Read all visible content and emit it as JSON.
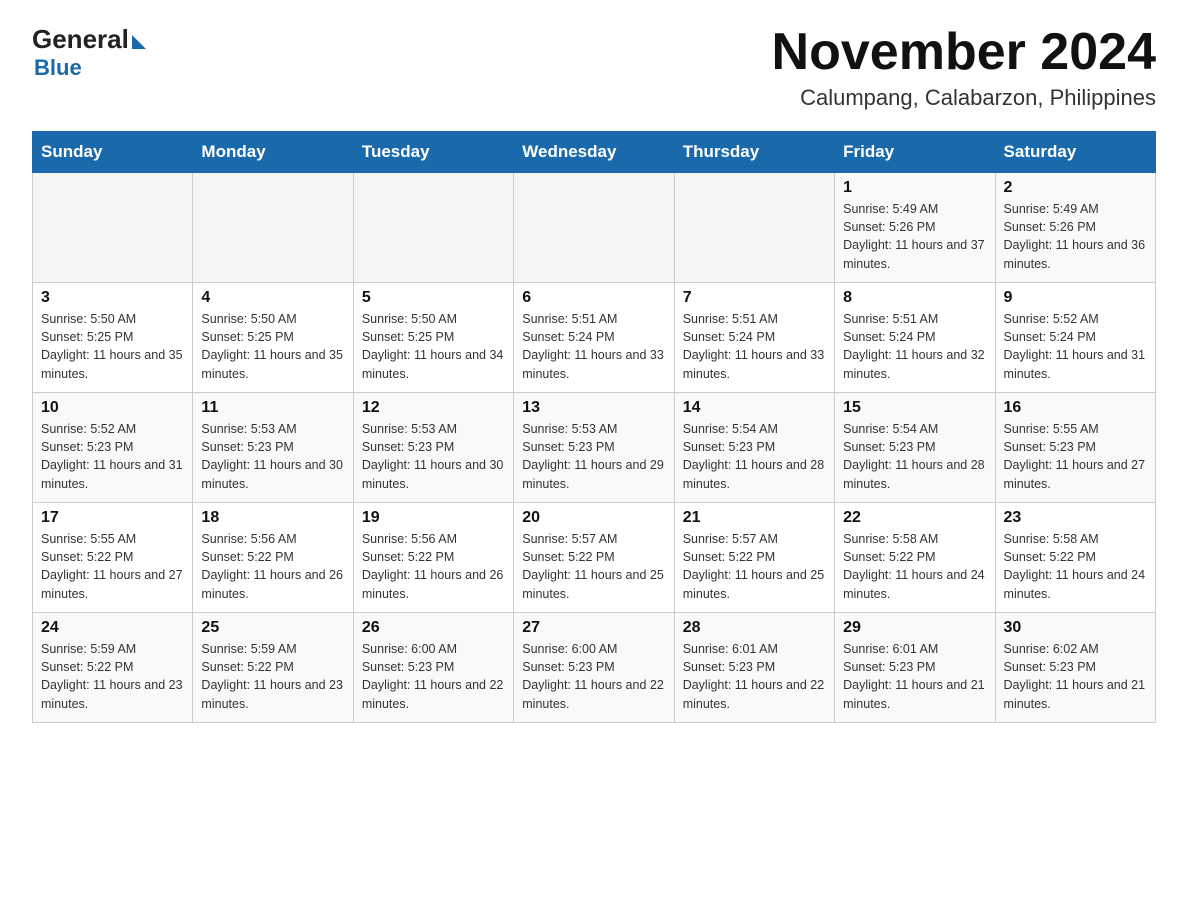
{
  "header": {
    "logo_general": "General",
    "logo_blue": "Blue",
    "month_title": "November 2024",
    "location": "Calumpang, Calabarzon, Philippines"
  },
  "days_of_week": [
    "Sunday",
    "Monday",
    "Tuesday",
    "Wednesday",
    "Thursday",
    "Friday",
    "Saturday"
  ],
  "weeks": [
    [
      {
        "day": "",
        "sunrise": "",
        "sunset": "",
        "daylight": ""
      },
      {
        "day": "",
        "sunrise": "",
        "sunset": "",
        "daylight": ""
      },
      {
        "day": "",
        "sunrise": "",
        "sunset": "",
        "daylight": ""
      },
      {
        "day": "",
        "sunrise": "",
        "sunset": "",
        "daylight": ""
      },
      {
        "day": "",
        "sunrise": "",
        "sunset": "",
        "daylight": ""
      },
      {
        "day": "1",
        "sunrise": "Sunrise: 5:49 AM",
        "sunset": "Sunset: 5:26 PM",
        "daylight": "Daylight: 11 hours and 37 minutes."
      },
      {
        "day": "2",
        "sunrise": "Sunrise: 5:49 AM",
        "sunset": "Sunset: 5:26 PM",
        "daylight": "Daylight: 11 hours and 36 minutes."
      }
    ],
    [
      {
        "day": "3",
        "sunrise": "Sunrise: 5:50 AM",
        "sunset": "Sunset: 5:25 PM",
        "daylight": "Daylight: 11 hours and 35 minutes."
      },
      {
        "day": "4",
        "sunrise": "Sunrise: 5:50 AM",
        "sunset": "Sunset: 5:25 PM",
        "daylight": "Daylight: 11 hours and 35 minutes."
      },
      {
        "day": "5",
        "sunrise": "Sunrise: 5:50 AM",
        "sunset": "Sunset: 5:25 PM",
        "daylight": "Daylight: 11 hours and 34 minutes."
      },
      {
        "day": "6",
        "sunrise": "Sunrise: 5:51 AM",
        "sunset": "Sunset: 5:24 PM",
        "daylight": "Daylight: 11 hours and 33 minutes."
      },
      {
        "day": "7",
        "sunrise": "Sunrise: 5:51 AM",
        "sunset": "Sunset: 5:24 PM",
        "daylight": "Daylight: 11 hours and 33 minutes."
      },
      {
        "day": "8",
        "sunrise": "Sunrise: 5:51 AM",
        "sunset": "Sunset: 5:24 PM",
        "daylight": "Daylight: 11 hours and 32 minutes."
      },
      {
        "day": "9",
        "sunrise": "Sunrise: 5:52 AM",
        "sunset": "Sunset: 5:24 PM",
        "daylight": "Daylight: 11 hours and 31 minutes."
      }
    ],
    [
      {
        "day": "10",
        "sunrise": "Sunrise: 5:52 AM",
        "sunset": "Sunset: 5:23 PM",
        "daylight": "Daylight: 11 hours and 31 minutes."
      },
      {
        "day": "11",
        "sunrise": "Sunrise: 5:53 AM",
        "sunset": "Sunset: 5:23 PM",
        "daylight": "Daylight: 11 hours and 30 minutes."
      },
      {
        "day": "12",
        "sunrise": "Sunrise: 5:53 AM",
        "sunset": "Sunset: 5:23 PM",
        "daylight": "Daylight: 11 hours and 30 minutes."
      },
      {
        "day": "13",
        "sunrise": "Sunrise: 5:53 AM",
        "sunset": "Sunset: 5:23 PM",
        "daylight": "Daylight: 11 hours and 29 minutes."
      },
      {
        "day": "14",
        "sunrise": "Sunrise: 5:54 AM",
        "sunset": "Sunset: 5:23 PM",
        "daylight": "Daylight: 11 hours and 28 minutes."
      },
      {
        "day": "15",
        "sunrise": "Sunrise: 5:54 AM",
        "sunset": "Sunset: 5:23 PM",
        "daylight": "Daylight: 11 hours and 28 minutes."
      },
      {
        "day": "16",
        "sunrise": "Sunrise: 5:55 AM",
        "sunset": "Sunset: 5:23 PM",
        "daylight": "Daylight: 11 hours and 27 minutes."
      }
    ],
    [
      {
        "day": "17",
        "sunrise": "Sunrise: 5:55 AM",
        "sunset": "Sunset: 5:22 PM",
        "daylight": "Daylight: 11 hours and 27 minutes."
      },
      {
        "day": "18",
        "sunrise": "Sunrise: 5:56 AM",
        "sunset": "Sunset: 5:22 PM",
        "daylight": "Daylight: 11 hours and 26 minutes."
      },
      {
        "day": "19",
        "sunrise": "Sunrise: 5:56 AM",
        "sunset": "Sunset: 5:22 PM",
        "daylight": "Daylight: 11 hours and 26 minutes."
      },
      {
        "day": "20",
        "sunrise": "Sunrise: 5:57 AM",
        "sunset": "Sunset: 5:22 PM",
        "daylight": "Daylight: 11 hours and 25 minutes."
      },
      {
        "day": "21",
        "sunrise": "Sunrise: 5:57 AM",
        "sunset": "Sunset: 5:22 PM",
        "daylight": "Daylight: 11 hours and 25 minutes."
      },
      {
        "day": "22",
        "sunrise": "Sunrise: 5:58 AM",
        "sunset": "Sunset: 5:22 PM",
        "daylight": "Daylight: 11 hours and 24 minutes."
      },
      {
        "day": "23",
        "sunrise": "Sunrise: 5:58 AM",
        "sunset": "Sunset: 5:22 PM",
        "daylight": "Daylight: 11 hours and 24 minutes."
      }
    ],
    [
      {
        "day": "24",
        "sunrise": "Sunrise: 5:59 AM",
        "sunset": "Sunset: 5:22 PM",
        "daylight": "Daylight: 11 hours and 23 minutes."
      },
      {
        "day": "25",
        "sunrise": "Sunrise: 5:59 AM",
        "sunset": "Sunset: 5:22 PM",
        "daylight": "Daylight: 11 hours and 23 minutes."
      },
      {
        "day": "26",
        "sunrise": "Sunrise: 6:00 AM",
        "sunset": "Sunset: 5:23 PM",
        "daylight": "Daylight: 11 hours and 22 minutes."
      },
      {
        "day": "27",
        "sunrise": "Sunrise: 6:00 AM",
        "sunset": "Sunset: 5:23 PM",
        "daylight": "Daylight: 11 hours and 22 minutes."
      },
      {
        "day": "28",
        "sunrise": "Sunrise: 6:01 AM",
        "sunset": "Sunset: 5:23 PM",
        "daylight": "Daylight: 11 hours and 22 minutes."
      },
      {
        "day": "29",
        "sunrise": "Sunrise: 6:01 AM",
        "sunset": "Sunset: 5:23 PM",
        "daylight": "Daylight: 11 hours and 21 minutes."
      },
      {
        "day": "30",
        "sunrise": "Sunrise: 6:02 AM",
        "sunset": "Sunset: 5:23 PM",
        "daylight": "Daylight: 11 hours and 21 minutes."
      }
    ]
  ]
}
